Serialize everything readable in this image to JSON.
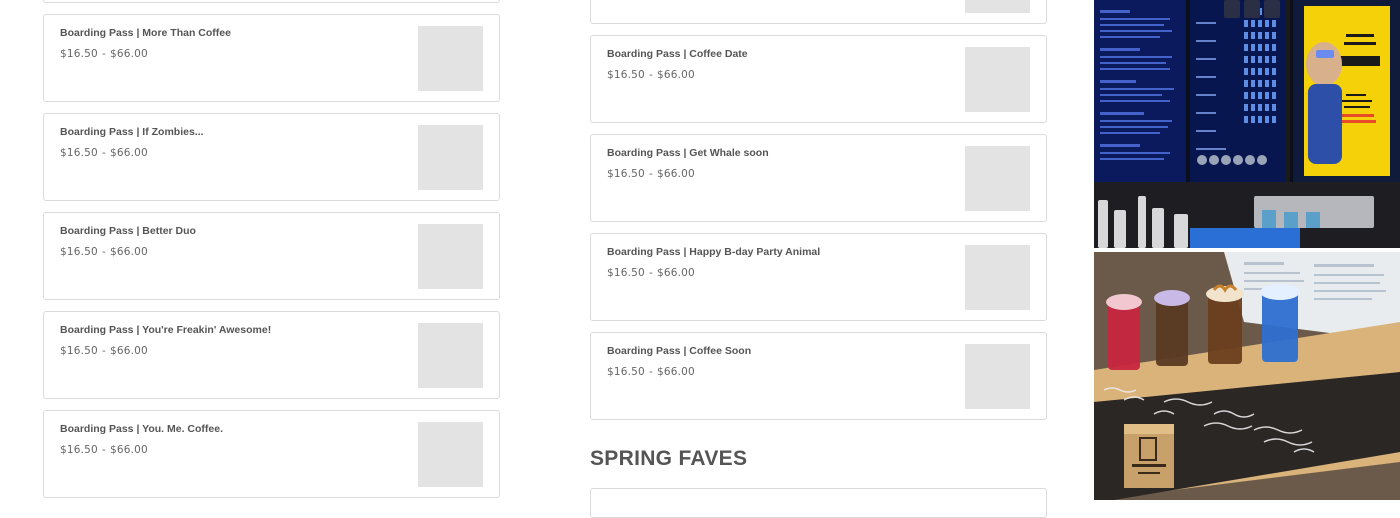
{
  "products_left": [
    {
      "title": "Boarding Pass | More Than Coffee",
      "price_min": "$16.50",
      "separator": "-",
      "price_max": "$66.00"
    },
    {
      "title": "Boarding Pass | If Zombies...",
      "price_min": "$16.50",
      "separator": "-",
      "price_max": "$66.00"
    },
    {
      "title": "Boarding Pass | Better Duo",
      "price_min": "$16.50",
      "separator": "-",
      "price_max": "$66.00"
    },
    {
      "title": "Boarding Pass | You're Freakin' Awesome!",
      "price_min": "$16.50",
      "separator": "-",
      "price_max": "$66.00"
    },
    {
      "title": "Boarding Pass | You. Me. Coffee.",
      "price_min": "$16.50",
      "separator": "-",
      "price_max": "$66.00"
    }
  ],
  "products_right": [
    {
      "title": "Boarding Pass | Coffee Date",
      "price_min": "$16.50",
      "separator": "-",
      "price_max": "$66.00"
    },
    {
      "title": "Boarding Pass | Get Whale soon",
      "price_min": "$16.50",
      "separator": "-",
      "price_max": "$66.00"
    },
    {
      "title": "Boarding Pass | Happy B-day Party Animal",
      "price_min": "$16.50",
      "separator": "-",
      "price_max": "$66.00"
    },
    {
      "title": "Boarding Pass | Coffee Soon",
      "price_min": "$16.50",
      "separator": "-",
      "price_max": "$66.00"
    }
  ],
  "section_heading": "SPRING FAVES",
  "photo1": {
    "menu_headings": [
      "SIGNATURE BREWS",
      "SPECIAL DRINKS",
      "COFFEE & ESPRESSO"
    ],
    "menu_items": [
      "STANDARD",
      "TREATS",
      "BREEZE",
      "TIME",
      "SWARM",
      "BOOST",
      "FLIGHT"
    ],
    "poster_text": [
      "YEP...",
      "ALL THE",
      "ARE GONE!",
      "OUR",
      "LAST FLIGHT",
      "TAKES OFF",
      "30 MINUTES",
      "BEFORE WE CLOSE"
    ]
  },
  "photo2": {
    "chalk_text": [
      "Strawberry",
      "Cheesecake",
      "Coldbrew",
      "with",
      "cloud",
      "Salted",
      "Caramel",
      "Toasted",
      "Coconut"
    ],
    "brand_text": [
      "the",
      "KUBE"
    ],
    "handle_text": "@BlueBeanVibe"
  },
  "colors": {
    "card_border": "#dadada",
    "title": "#555555",
    "price": "#666666",
    "thumb": "#e3e3e3"
  }
}
